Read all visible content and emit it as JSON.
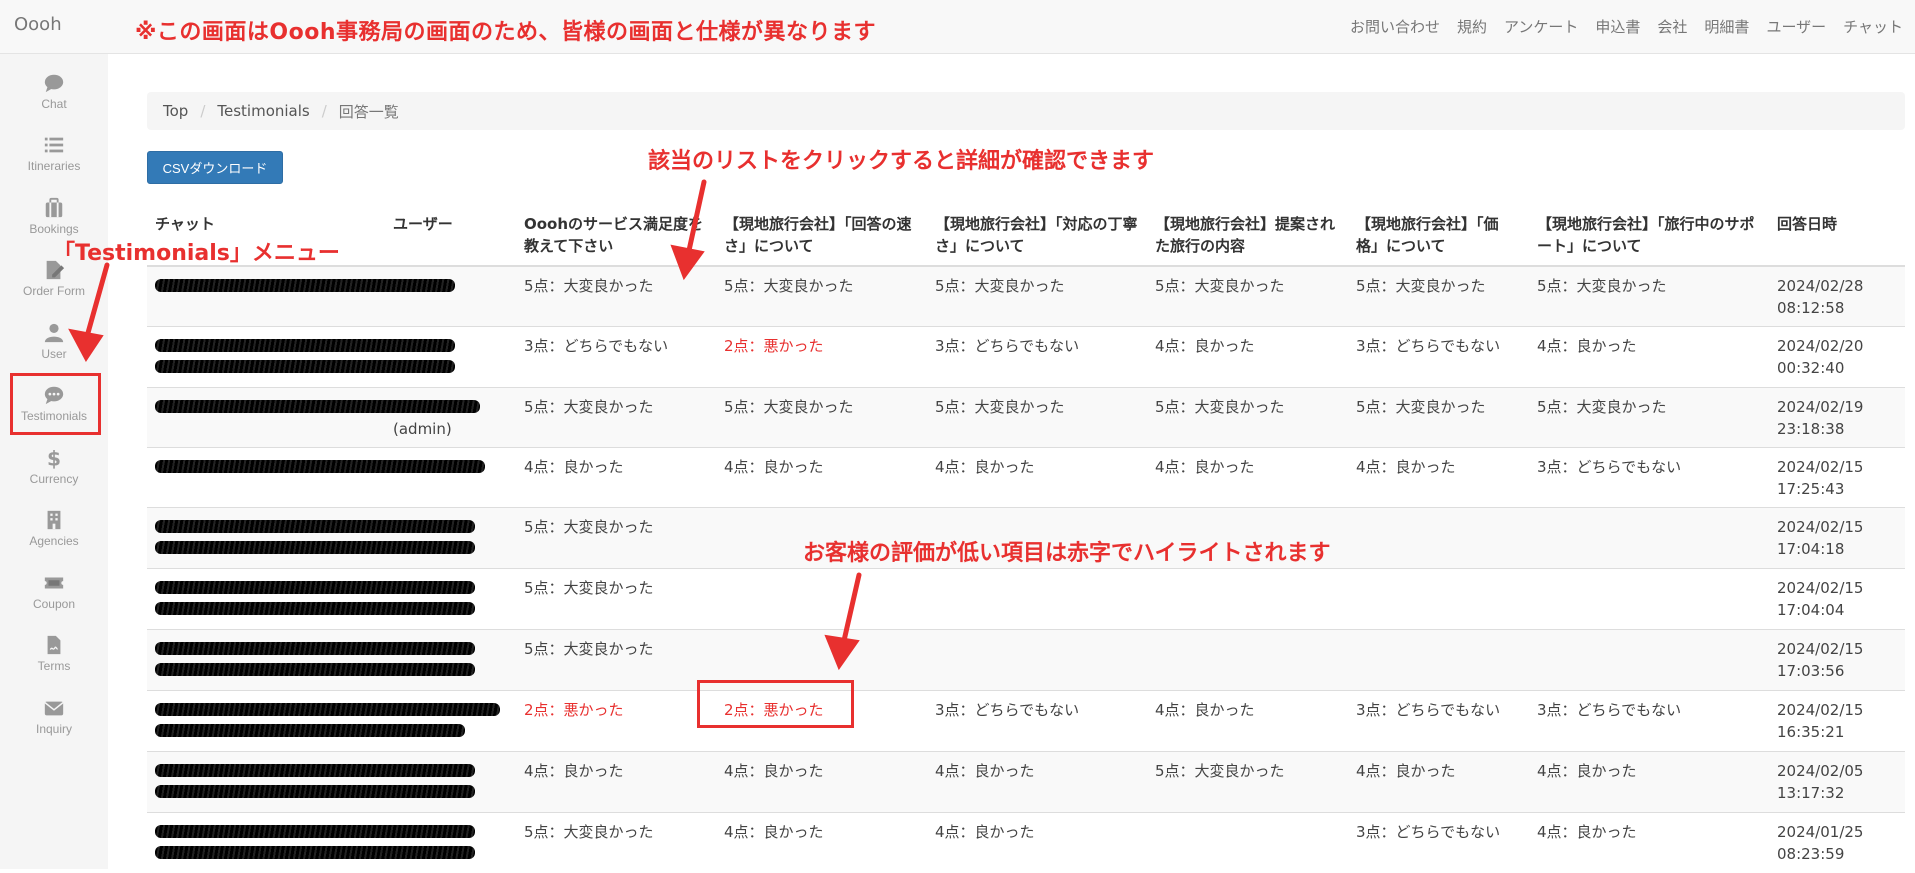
{
  "navbar": {
    "brand": "Oooh",
    "notice": "※この画面はOooh事務局の画面のため、皆様の画面と仕様が異なります",
    "links": [
      "お問い合わせ",
      "規約",
      "アンケート",
      "申込書",
      "会社",
      "明細書",
      "ユーザー",
      "チャット"
    ]
  },
  "sidebar": {
    "items": [
      {
        "label": "Chat",
        "icon": "chat-bubble-icon"
      },
      {
        "label": "Itineraries",
        "icon": "list-icon"
      },
      {
        "label": "Bookings",
        "icon": "suitcase-icon"
      },
      {
        "label": "Order Form",
        "icon": "edit-document-icon"
      },
      {
        "label": "User",
        "icon": "user-icon"
      },
      {
        "label": "Testimonials",
        "icon": "comment-dots-icon"
      },
      {
        "label": "Currency",
        "icon": "dollar-icon"
      },
      {
        "label": "Agencies",
        "icon": "building-icon"
      },
      {
        "label": "Coupon",
        "icon": "ticket-icon"
      },
      {
        "label": "Terms",
        "icon": "file-signature-icon"
      },
      {
        "label": "Inquiry",
        "icon": "envelope-icon"
      }
    ]
  },
  "breadcrumb": {
    "items": [
      "Top",
      "Testimonials"
    ],
    "current": "回答一覧"
  },
  "toolbar": {
    "csv_label": "CSVダウンロード"
  },
  "table": {
    "headers": [
      "チャット",
      "ユーザー",
      "Ooohのサービス満足度を教えて下さい",
      "【現地旅行会社】「回答の速さ」について",
      "【現地旅行会社】「対応の丁寧さ」について",
      "【現地旅行会社】提案された旅行の内容",
      "【現地旅行会社】「価格」について",
      "【現地旅行会社】「旅行中のサポート」について",
      "回答日時"
    ],
    "rows": [
      {
        "user": "",
        "cells": [
          "5点：大変良かった",
          "5点：大変良かった",
          "5点：大変良かった",
          "5点：大変良かった",
          "5点：大変良かった",
          "5点：大変良かった"
        ],
        "low": [
          false,
          false,
          false,
          false,
          false,
          false
        ],
        "date": "2024/02/28",
        "time": "08:12:58"
      },
      {
        "user": "",
        "cells": [
          "3点：どちらでもない",
          "2点：悪かった",
          "3点：どちらでもない",
          "4点：良かった",
          "3点：どちらでもない",
          "4点：良かった"
        ],
        "low": [
          false,
          true,
          false,
          false,
          false,
          false
        ],
        "date": "2024/02/20",
        "time": "00:32:40"
      },
      {
        "user": "(admin)",
        "cells": [
          "5点：大変良かった",
          "5点：大変良かった",
          "5点：大変良かった",
          "5点：大変良かった",
          "5点：大変良かった",
          "5点：大変良かった"
        ],
        "low": [
          false,
          false,
          false,
          false,
          false,
          false
        ],
        "date": "2024/02/19",
        "time": "23:18:38"
      },
      {
        "user": "",
        "cells": [
          "4点：良かった",
          "4点：良かった",
          "4点：良かった",
          "4点：良かった",
          "4点：良かった",
          "3点：どちらでもない"
        ],
        "low": [
          false,
          false,
          false,
          false,
          false,
          false
        ],
        "date": "2024/02/15",
        "time": "17:25:43"
      },
      {
        "user": "",
        "cells": [
          "5点：大変良かった",
          "",
          "",
          "",
          "",
          ""
        ],
        "low": [
          false,
          false,
          false,
          false,
          false,
          false
        ],
        "date": "2024/02/15",
        "time": "17:04:18"
      },
      {
        "user": "",
        "cells": [
          "5点：大変良かった",
          "",
          "",
          "",
          "",
          ""
        ],
        "low": [
          false,
          false,
          false,
          false,
          false,
          false
        ],
        "date": "2024/02/15",
        "time": "17:04:04"
      },
      {
        "user": "",
        "cells": [
          "5点：大変良かった",
          "",
          "",
          "",
          "",
          ""
        ],
        "low": [
          false,
          false,
          false,
          false,
          false,
          false
        ],
        "date": "2024/02/15",
        "time": "17:03:56"
      },
      {
        "user": "",
        "cells": [
          "2点：悪かった",
          "2点：悪かった",
          "3点：どちらでもない",
          "4点：良かった",
          "3点：どちらでもない",
          "3点：どちらでもない"
        ],
        "low": [
          true,
          true,
          false,
          false,
          false,
          false
        ],
        "date": "2024/02/15",
        "time": "16:35:21"
      },
      {
        "user": "",
        "cells": [
          "4点：良かった",
          "4点：良かった",
          "4点：良かった",
          "5点：大変良かった",
          "4点：良かった",
          "4点：良かった"
        ],
        "low": [
          false,
          false,
          false,
          false,
          false,
          false
        ],
        "date": "2024/02/05",
        "time": "13:17:32"
      },
      {
        "user": "",
        "cells": [
          "5点：大変良かった",
          "4点：良かった",
          "4点：良かった",
          "",
          "3点：どちらでもない",
          "4点：良かった"
        ],
        "low": [
          false,
          false,
          false,
          false,
          false,
          false
        ],
        "date": "2024/01/25",
        "time": "08:23:59"
      }
    ]
  },
  "annotations": {
    "menu": "「Testimonials」メニュー",
    "click_list": "該当のリストをクリックすると詳細が確認できます",
    "low_rating": "お客様の評価が低い項目は赤字でハイライトされます"
  },
  "colors": {
    "accent": "#e8302f",
    "primary_button": "#337ab7"
  }
}
